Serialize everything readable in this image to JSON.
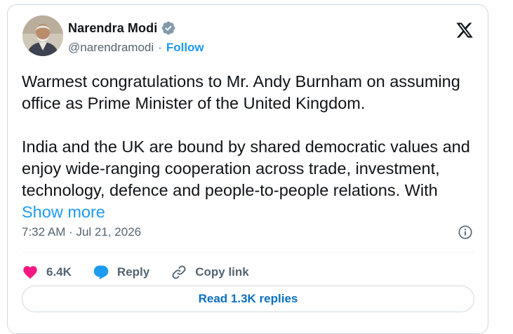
{
  "author": {
    "name": "Narendra Modi",
    "handle": "@narendramodi",
    "separator": "·",
    "follow_label": "Follow"
  },
  "tweet": {
    "paragraph_1": "Warmest congratulations to Mr. Andy Burnham on assuming office as Prime Minister of the United Kingdom.",
    "paragraph_2": "India and the UK are bound by shared democratic values and enjoy wide-ranging cooperation across trade, investment, technology, defence and people-to-people relations. With",
    "show_more_label": "Show more",
    "timestamp": "7:32 AM · Jul 21, 2026"
  },
  "actions": {
    "like_count": "6.4K",
    "reply_label": "Reply",
    "copy_link_label": "Copy link"
  },
  "replies_button_label": "Read 1.3K replies",
  "colors": {
    "accent": "#1d9bf0",
    "like": "#f91880",
    "text_secondary": "#536471",
    "border": "#cfd9de"
  },
  "icons": [
    "verified-badge-icon",
    "x-logo-icon",
    "info-icon",
    "heart-icon",
    "reply-icon",
    "link-icon"
  ]
}
